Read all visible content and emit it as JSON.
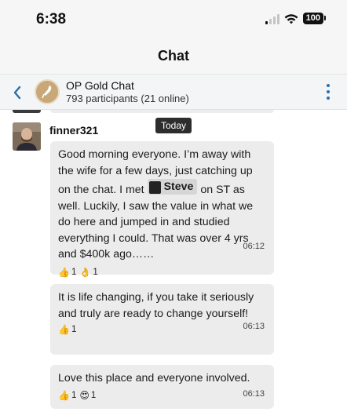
{
  "status": {
    "time": "6:38",
    "battery": "100"
  },
  "nav": {
    "title": "Chat"
  },
  "chat": {
    "name": "OP Gold Chat",
    "participants": "793 participants (21 online)"
  },
  "date_divider": "Today",
  "messages": {
    "username": "finner321",
    "m1": {
      "text_before": "Good morning everyone. I’m away with the wife for a few days, just catching up on the chat. I met ",
      "mention": "Steve",
      "text_after": " on ST as well. Luckily, I saw the value in what we do here and jumped in and studied everything I could. That was over 4 yrs and $400k ago……",
      "time": "06:12",
      "reactions": [
        {
          "icon": "thumbs-up",
          "glyph": "👍",
          "count": "1"
        },
        {
          "icon": "ok-hand",
          "glyph": "👌",
          "count": "1"
        }
      ]
    },
    "m2": {
      "text": "It is life changing, if you take it seriously and truly are ready to change yourself!",
      "time": "06:13",
      "reactions": [
        {
          "icon": "thumbs-up",
          "glyph": "👍",
          "count": "1"
        }
      ]
    },
    "m3": {
      "text": "Love this place and everyone involved.",
      "time": "06:13",
      "reactions": [
        {
          "icon": "thumbs-up",
          "glyph": "👍",
          "count": "1"
        },
        {
          "icon": "heart-eyes",
          "glyph": "😍",
          "count": "1"
        }
      ]
    }
  },
  "colors": {
    "accent": "#2a6fa8",
    "bubble": "#ececec",
    "date_pill": "#2d2d2d"
  }
}
